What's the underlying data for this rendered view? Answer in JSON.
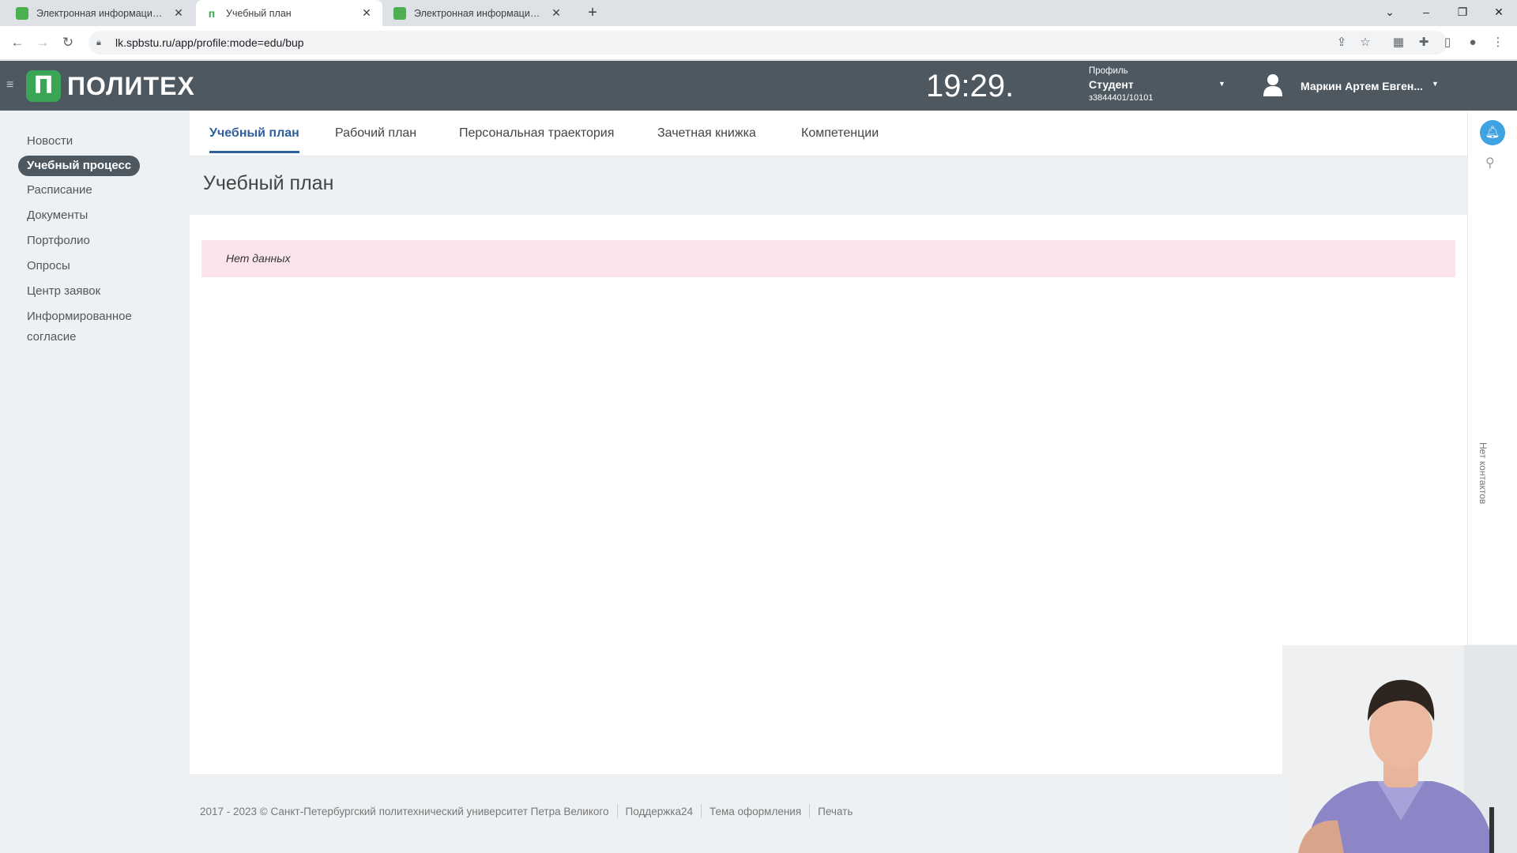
{
  "browser": {
    "tabs": [
      {
        "title": "Электронная информационно-",
        "active": false
      },
      {
        "title": "Учебный план",
        "active": true
      },
      {
        "title": "Электронная информационно-",
        "active": false
      }
    ],
    "new_tab_label": "+",
    "url": "lk.spbstu.ru/app/profile:mode=edu/bup"
  },
  "header": {
    "logo_mark": "П",
    "logo_text": "ПОЛИТЕХ",
    "clock": "19:29.",
    "profile_label": "Профиль",
    "profile_role": "Студент",
    "profile_code": "з3844401/10101",
    "user_name": "Маркин Артем Евген..."
  },
  "sidebar": {
    "items": [
      {
        "label": "Новости"
      },
      {
        "label": "Учебный процесс",
        "active": true
      },
      {
        "label": "Расписание"
      },
      {
        "label": "Документы"
      },
      {
        "label": "Портфолио"
      },
      {
        "label": "Опросы"
      },
      {
        "label": "Центр заявок"
      },
      {
        "label": "Информированное"
      },
      {
        "label": "согласие"
      }
    ]
  },
  "main": {
    "tabs": [
      {
        "label": "Учебный план",
        "active": true
      },
      {
        "label": "Рабочий план"
      },
      {
        "label": "Персональная траектория"
      },
      {
        "label": "Зачетная книжка"
      },
      {
        "label": "Компетенции"
      }
    ],
    "page_title": "Учебный план",
    "empty_message": "Нет данных"
  },
  "rail": {
    "no_contacts": "Нет контактов"
  },
  "footer": {
    "copyright": "2017 - 2023 © Санкт-Петербургский политехнический университет Петра Великого",
    "support": "Поддержка24",
    "theme": "Тема оформления",
    "print": "Печать"
  },
  "colors": {
    "header_bg": "#4e5860",
    "brand_green": "#3aa655",
    "active_tab": "#2f5f9e",
    "alert_bg": "#fbe4ea",
    "bell": "#3ea3e0"
  }
}
